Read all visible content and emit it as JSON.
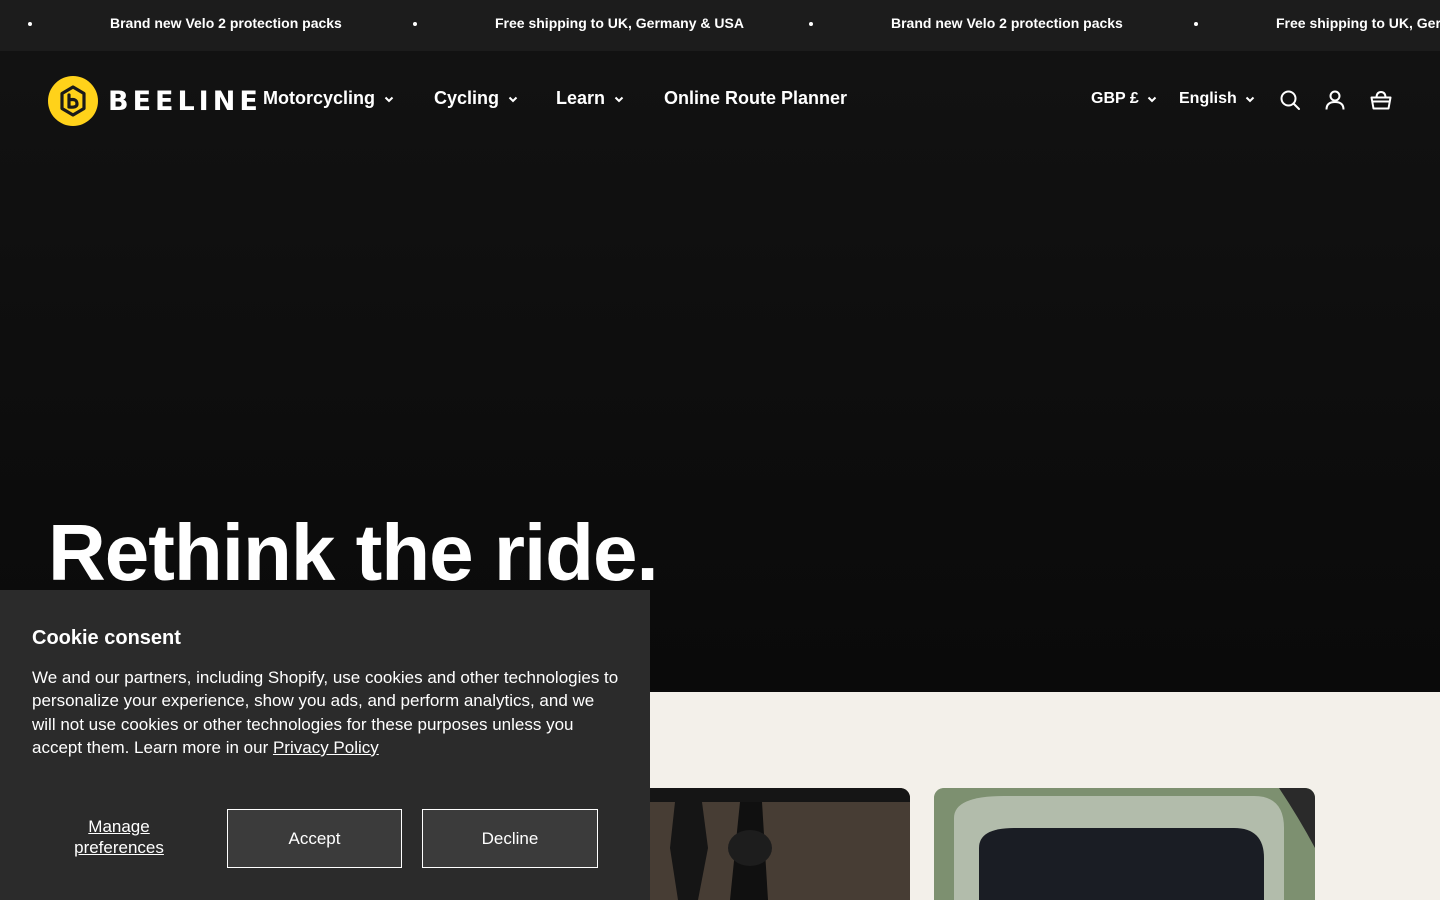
{
  "announcement": {
    "messages": [
      "Brand new Velo 2 protection packs",
      "Free shipping to UK, Germany & USA",
      "Brand new Velo 2 protection packs",
      "Free shipping to UK, Germany & USA"
    ]
  },
  "header": {
    "logo_text": "BEELINE",
    "brand_color": "#ffd21a",
    "nav": [
      {
        "label": "Motorcycling",
        "icon": "chevron-down-icon"
      },
      {
        "label": "Cycling",
        "icon": "chevron-down-icon"
      },
      {
        "label": "Learn",
        "icon": "chevron-down-icon"
      },
      {
        "label": "Online Route Planner"
      }
    ],
    "currency": "GBP £",
    "language": "English",
    "icons": [
      "search-icon",
      "account-icon",
      "cart-icon"
    ]
  },
  "hero": {
    "title": "Rethink the ride."
  },
  "cookie": {
    "title": "Cookie consent",
    "body": "We and our partners, including Shopify, use cookies and other technologies to personalize your experience, show you ads, and perform analytics, and we will not use cookies or other technologies for these purposes unless you accept them. Learn more in our ",
    "privacy_link": "Privacy Policy",
    "manage_label": "Manage preferences",
    "accept_label": "Accept",
    "decline_label": "Decline"
  }
}
